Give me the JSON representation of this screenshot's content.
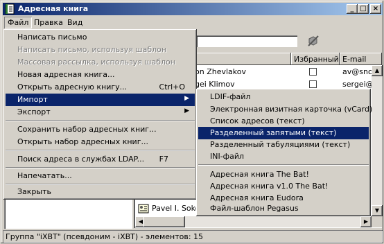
{
  "window": {
    "title": "Адресная книга"
  },
  "titlebar_buttons": {
    "minimize": "_",
    "maximize": "□",
    "close": "×"
  },
  "menubar": {
    "file": "Файл",
    "edit": "Правка",
    "view": "Вид"
  },
  "columns": {
    "favorite": "Избранный",
    "email": "E-mail"
  },
  "rows": [
    {
      "name": "on Zhevlakov",
      "email": "av@snow"
    },
    {
      "name": "gei Klimov",
      "email": "sergei@s"
    },
    {
      "name": "Pavel I. Soko",
      "email": ""
    }
  ],
  "file_menu": {
    "items": [
      {
        "label": "Написать письмо",
        "shortcut": ""
      },
      {
        "label": "Написать письмо, используя шаблон",
        "shortcut": ""
      },
      {
        "label": "Массовая рассылка, используя шаблон",
        "shortcut": ""
      },
      {
        "label": "Новая адресная книга...",
        "shortcut": ""
      },
      {
        "label": "Открыть адресную книгу...",
        "shortcut": "Ctrl+O"
      },
      {
        "label": "Импорт",
        "shortcut": ""
      },
      {
        "label": "Экспорт",
        "shortcut": ""
      },
      {
        "label": "Сохранить набор адресных книг...",
        "shortcut": ""
      },
      {
        "label": "Открыть набор адресных книг...",
        "shortcut": ""
      },
      {
        "label": "Поиск адреса в службах LDAP...",
        "shortcut": "F7"
      },
      {
        "label": "Напечатать...",
        "shortcut": ""
      },
      {
        "label": "Закрыть",
        "shortcut": ""
      }
    ]
  },
  "import_menu": {
    "items": [
      "LDIF-файл",
      "Электронная визитная карточка (vCard)",
      "Список адресов (текст)",
      "Разделенный запятыми (текст)",
      "Разделенный табуляциями (текст)",
      "INI-файл",
      "Адресная книга The Bat!",
      "Адресная книга v1.0 The Bat!",
      "Адресная книга Eudora",
      "Файл-шаблон Pegasus"
    ]
  },
  "status": {
    "text": "Группа \"iXBT\" (псевдоним - iXBT) - элементов: 15"
  },
  "colors": {
    "selection": "#0a246a",
    "face": "#d4d0c8"
  }
}
